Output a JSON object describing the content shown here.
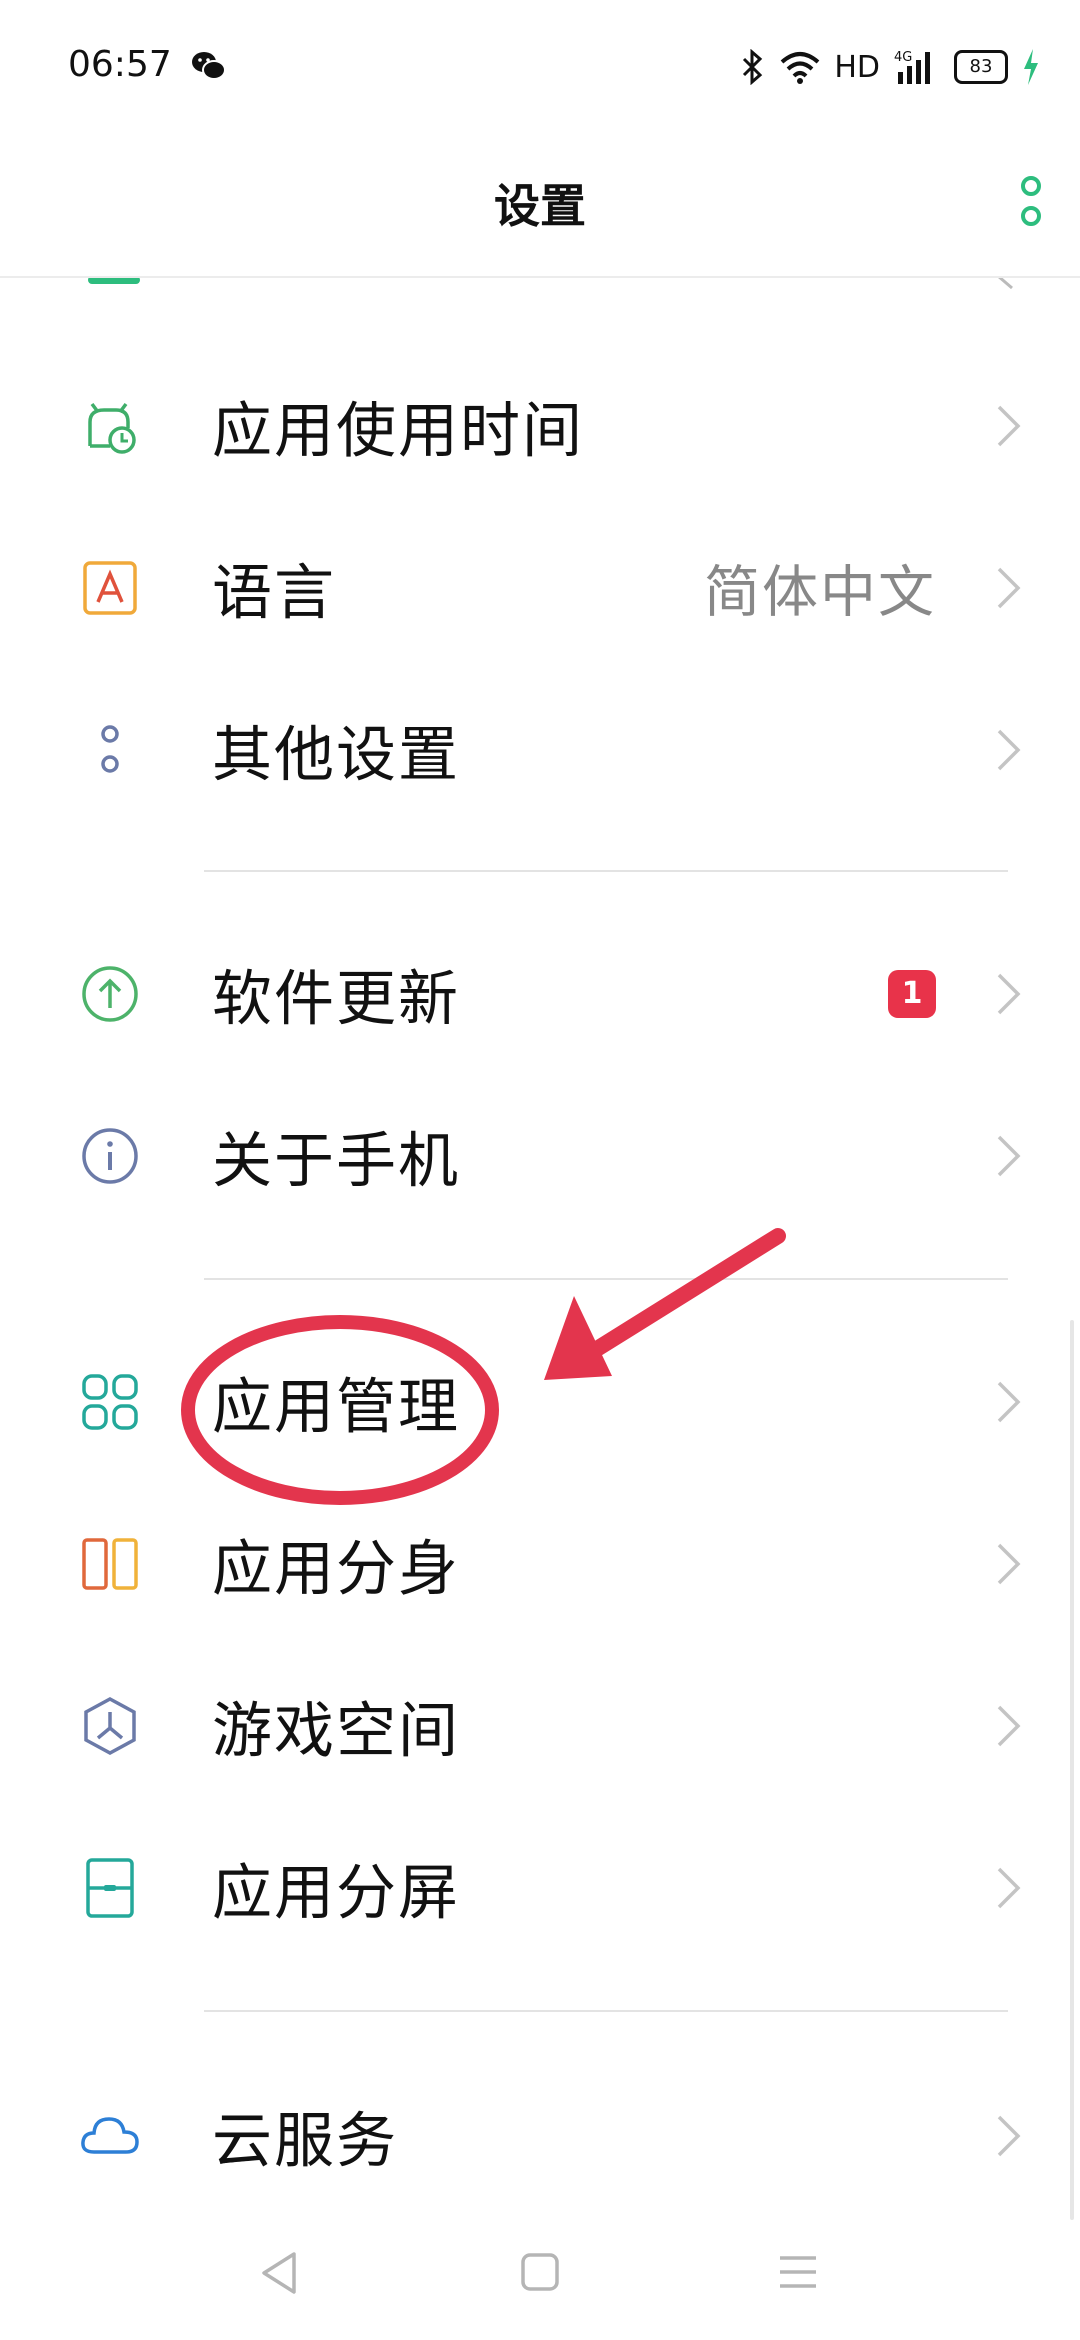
{
  "status_bar": {
    "time": "06:57",
    "network_label": "HD",
    "battery_level": "83"
  },
  "header": {
    "title": "设置"
  },
  "settings_list": {
    "items": [
      {
        "label": "应用使用时间",
        "icon": "app-usage-time-icon"
      },
      {
        "label": "语言",
        "value": "简体中文",
        "icon": "language-icon"
      },
      {
        "label": "其他设置",
        "icon": "other-settings-icon"
      },
      {
        "label": "软件更新",
        "badge": "1",
        "icon": "software-update-icon"
      },
      {
        "label": "关于手机",
        "icon": "about-phone-icon"
      },
      {
        "label": "应用管理",
        "icon": "app-management-icon"
      },
      {
        "label": "应用分身",
        "icon": "app-clone-icon"
      },
      {
        "label": "游戏空间",
        "icon": "game-space-icon"
      },
      {
        "label": "应用分屏",
        "icon": "split-screen-icon"
      },
      {
        "label": "云服务",
        "icon": "cloud-service-icon"
      }
    ]
  },
  "colors": {
    "badge": "#e8334a",
    "annotation": "#e3354d",
    "accent_green": "#2dbd7e"
  }
}
